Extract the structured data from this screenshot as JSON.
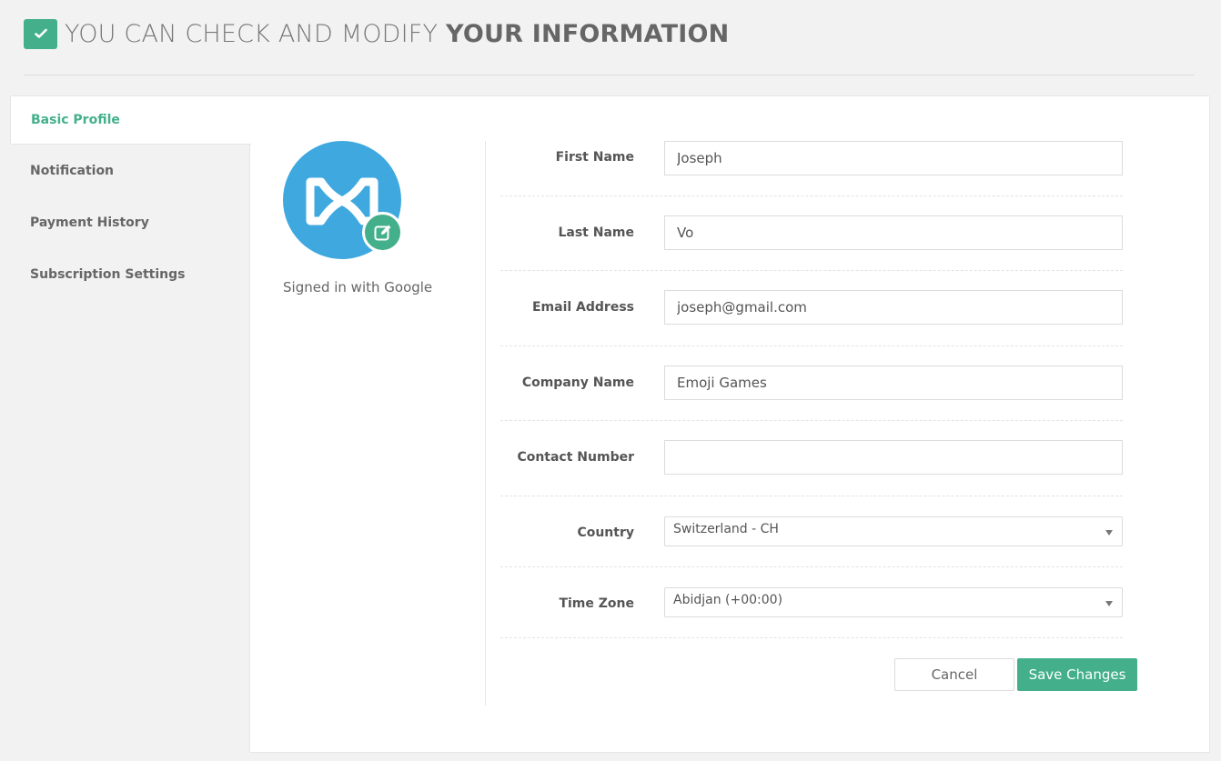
{
  "header": {
    "title_light": "YOU CAN CHECK AND MODIFY",
    "title_bold": "YOUR INFORMATION"
  },
  "sidebar": {
    "items": [
      {
        "label": "Basic Profile",
        "active": true
      },
      {
        "label": "Notification",
        "active": false
      },
      {
        "label": "Payment History",
        "active": false
      },
      {
        "label": "Subscription Settings",
        "active": false
      }
    ]
  },
  "profile": {
    "signed_in_text": "Signed in with Google"
  },
  "form": {
    "first_name": {
      "label": "First Name",
      "value": "Joseph"
    },
    "last_name": {
      "label": "Last Name",
      "value": "Vo"
    },
    "email": {
      "label": "Email Address",
      "value": "joseph@gmail.com"
    },
    "company": {
      "label": "Company Name",
      "value": "Emoji Games"
    },
    "contact": {
      "label": "Contact Number",
      "value": ""
    },
    "country": {
      "label": "Country",
      "value": "Switzerland - CH"
    },
    "timezone": {
      "label": "Time Zone",
      "value": "Abidjan (+00:00)"
    }
  },
  "actions": {
    "cancel_label": "Cancel",
    "save_label": "Save Changes"
  },
  "colors": {
    "accent": "#43b08b",
    "avatar_bg": "#3fa9df"
  },
  "icons": {
    "header": "check-icon",
    "avatar_edit": "edit-icon",
    "select": "caret-down-icon"
  }
}
